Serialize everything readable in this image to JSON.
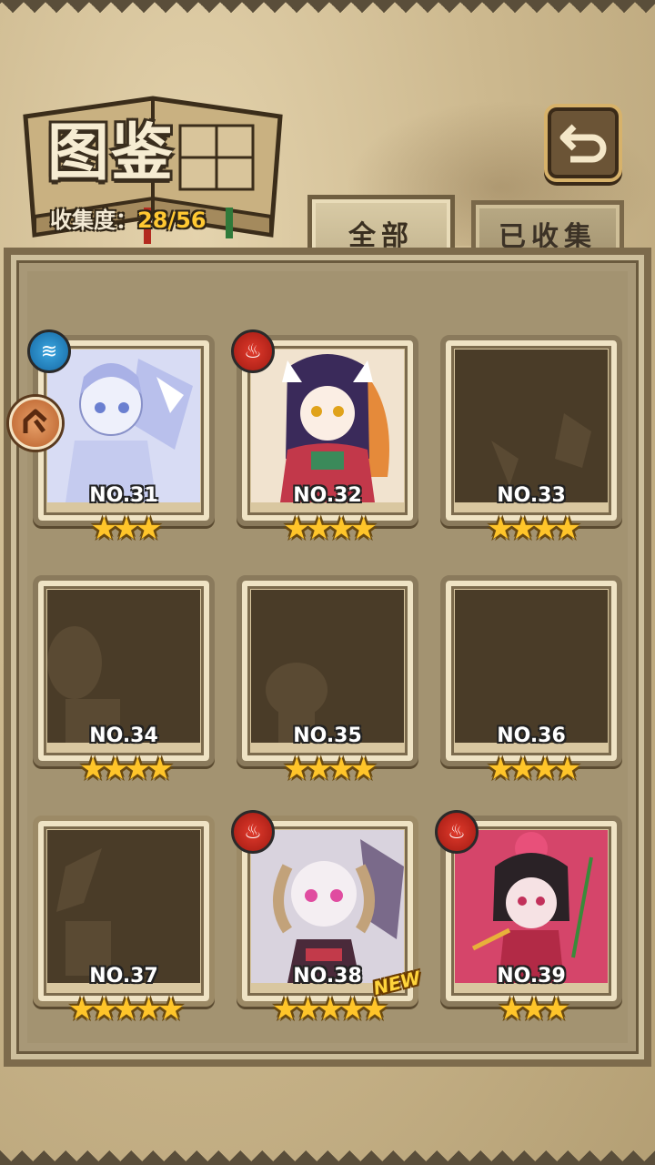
{
  "header": {
    "title": "图鉴",
    "collection_label": "收集度：",
    "collection_value": "28/56"
  },
  "tabs": [
    {
      "label": "全部",
      "active": true
    },
    {
      "label": "已收集",
      "active": false
    }
  ],
  "cards": [
    {
      "number": "NO.31",
      "stars": "★★★",
      "attribute": "water-icon",
      "collected": true,
      "is_new": false
    },
    {
      "number": "NO.32",
      "stars": "★★★★",
      "attribute": "fire-icon",
      "collected": true,
      "is_new": false
    },
    {
      "number": "NO.33",
      "stars": "★★★★",
      "attribute": "",
      "collected": false,
      "is_new": false
    },
    {
      "number": "NO.34",
      "stars": "★★★★",
      "attribute": "",
      "collected": false,
      "is_new": false
    },
    {
      "number": "NO.35",
      "stars": "★★★★",
      "attribute": "",
      "collected": false,
      "is_new": false
    },
    {
      "number": "NO.36",
      "stars": "★★★★",
      "attribute": "",
      "collected": false,
      "is_new": false
    },
    {
      "number": "NO.37",
      "stars": "★★★★★",
      "attribute": "",
      "collected": false,
      "is_new": false
    },
    {
      "number": "NO.38",
      "stars": "★★★★★",
      "attribute": "fire-icon",
      "collected": true,
      "is_new": true
    },
    {
      "number": "NO.39",
      "stars": "★★★",
      "attribute": "fire-icon",
      "collected": true,
      "is_new": false
    }
  ],
  "new_tag": "NEW",
  "colors": {
    "accent": "#ffc832",
    "star": "#ffc52a",
    "fire": "#c5231a",
    "water": "#2a88c8",
    "silhouette": "#4a3c28"
  }
}
